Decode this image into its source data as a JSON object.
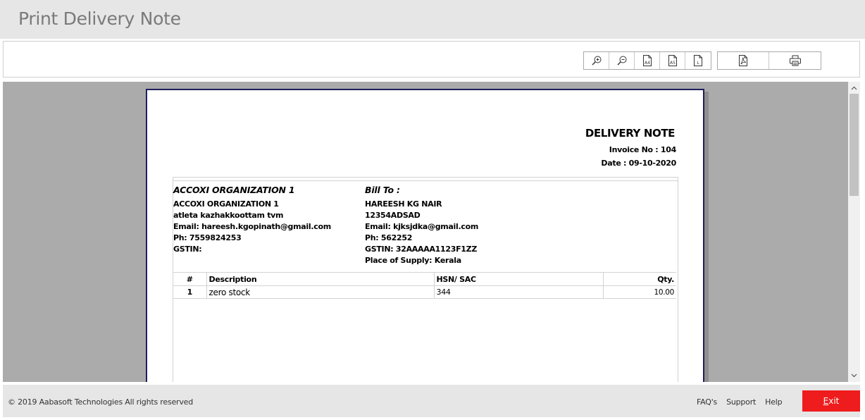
{
  "window": {
    "title": "Print Delivery Note"
  },
  "toolbar": {
    "icons": [
      "zoom-in-icon",
      "zoom-out-icon",
      "a4-page-icon",
      "a5-page-icon",
      "letter-page-icon",
      "pdf-icon",
      "printer-icon"
    ],
    "labels": {
      "a4": "A4",
      "a5": "A5",
      "letter": "L"
    }
  },
  "document": {
    "title": "DELIVERY NOTE",
    "invoice_no": "Invoice No : 104",
    "date": "Date : 09-10-2020",
    "from": {
      "heading": "ACCOXI ORGANIZATION 1",
      "name": "ACCOXI ORGANIZATION 1",
      "address": "atleta kazhakkoottam tvm",
      "email": "Email: hareesh.kgopinath@gmail.com",
      "phone": "Ph: 7559824253",
      "gstin": "GSTIN:"
    },
    "bill_to": {
      "heading": "Bill To :",
      "name": "HAREESH KG NAIR",
      "code": "12354ADSAD",
      "email": "Email: kjksjdka@gmail.com",
      "phone": "Ph: 562252",
      "gstin": "GSTIN: 32AAAAA1123F1ZZ",
      "place_of_supply": "Place of Supply: Kerala"
    },
    "table": {
      "headers": {
        "num": "#",
        "description": "Description",
        "hsn": "HSN/ SAC",
        "qty": "Qty."
      },
      "rows": [
        {
          "num": "1",
          "description": "zero stock",
          "hsn": "344",
          "qty": "10.00"
        }
      ]
    }
  },
  "scrollbar": {
    "up": "^",
    "down": "v"
  },
  "footer": {
    "copyright": "© 2019 Aabasoft Technologies All rights reserved",
    "links": [
      "FAQ's",
      "Support",
      "Help"
    ],
    "exit_label_ul": "E",
    "exit_label_rest": "xit"
  },
  "colors": {
    "exit_button": "#ee1c1c",
    "page_border": "#1e1e5e",
    "viewer_bg": "#ababab",
    "header_bg": "#e6e6e6"
  }
}
